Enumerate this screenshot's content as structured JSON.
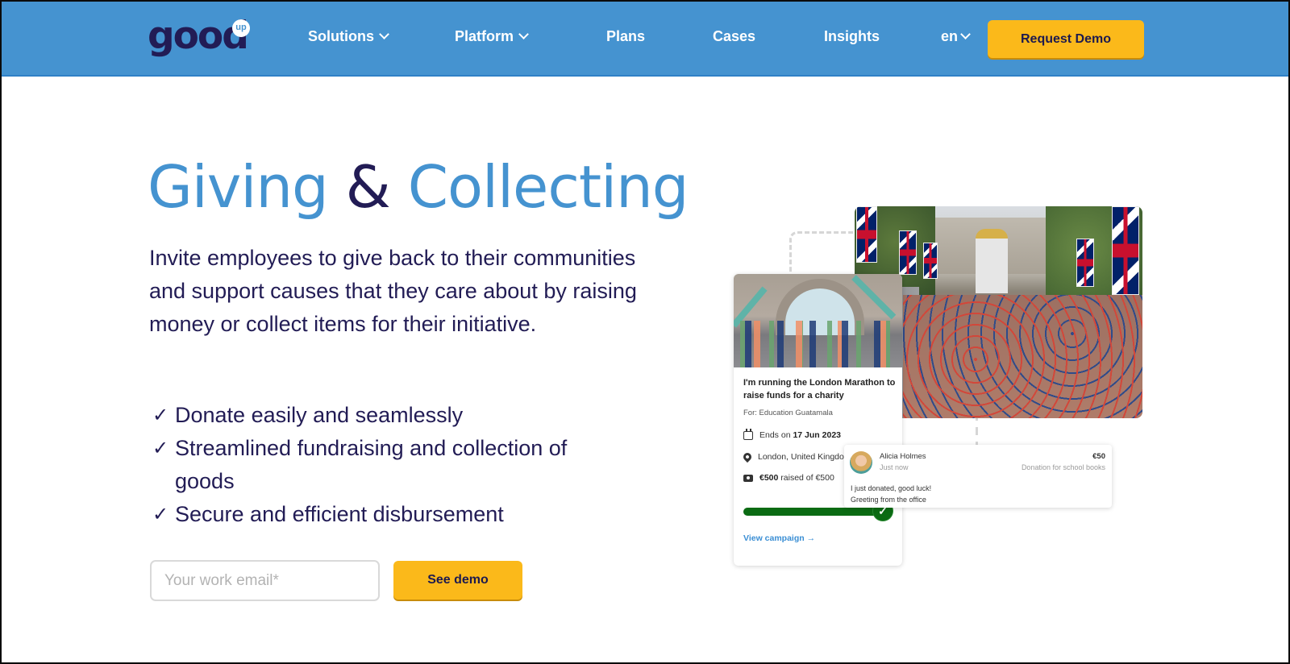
{
  "header": {
    "logo_text": "good",
    "logo_badge": "up",
    "nav": [
      {
        "label": "Solutions",
        "has_dropdown": true
      },
      {
        "label": "Platform",
        "has_dropdown": true
      },
      {
        "label": "Plans",
        "has_dropdown": false
      },
      {
        "label": "Cases",
        "has_dropdown": false
      },
      {
        "label": "Insights",
        "has_dropdown": false
      }
    ],
    "language": "en",
    "cta_label": "Request Demo",
    "colors": {
      "bar": "#4593d0",
      "cta": "#fbb91a",
      "brand_dark": "#221c55"
    }
  },
  "hero": {
    "title_part1": "Giving",
    "title_amp": "&",
    "title_part2": "Collecting",
    "description": "Invite employees to give back to their communities and support causes that they care about by raising money or collect items for their initiative.",
    "check_glyph": "✓",
    "features": [
      "Donate easily and seamlessly",
      "Streamlined fundraising and collection of goods",
      "Secure and efficient disbursement"
    ],
    "email_placeholder": "Your work email*",
    "email_value": "",
    "submit_label": "See demo"
  },
  "illustration": {
    "campaign_card": {
      "title": "I'm running the London Marathon to raise funds for a charity",
      "for_label": "For: Education Guatamala",
      "ends_prefix": "Ends on ",
      "ends_date": "17 Jun 2023",
      "location": "London, United Kingdom",
      "raised_amount": "€500",
      "raised_suffix": " raised of €500",
      "progress_fraction": 1.0,
      "progress_icon": "✓",
      "link_label": "View campaign →",
      "progress_color": "#0b6b13"
    },
    "donation_card": {
      "donor_name": "Alicia Holmes",
      "time": "Just now",
      "amount": "€50",
      "purpose": "Donation for school books",
      "message_line1": "I just donated, good luck!",
      "message_line2": "Greeting from the office"
    }
  }
}
